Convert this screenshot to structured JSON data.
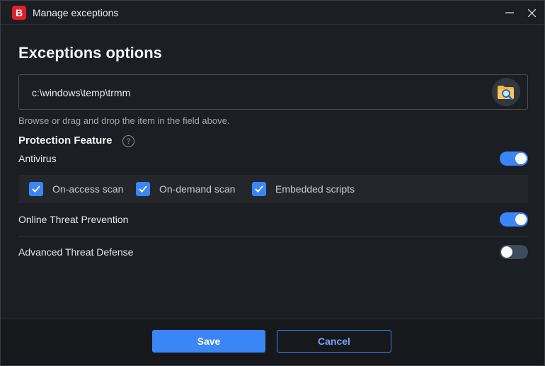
{
  "window": {
    "title": "Manage exceptions",
    "logo_letter": "B",
    "minimize_icon": "minimize-icon",
    "close_icon": "close-icon"
  },
  "content": {
    "heading": "Exceptions options",
    "path_value": "c:\\windows\\temp\\trmm",
    "browse_icon": "folder-search-icon",
    "hint": "Browse or drag and drop the item in the field above."
  },
  "protection": {
    "title": "Protection Feature",
    "help_icon_text": "?",
    "antivirus": {
      "label": "Antivirus",
      "enabled": true,
      "options": [
        {
          "label": "On-access scan",
          "checked": true
        },
        {
          "label": "On-demand scan",
          "checked": true
        },
        {
          "label": "Embedded scripts",
          "checked": true
        }
      ]
    },
    "online_threat": {
      "label": "Online Threat Prevention",
      "enabled": true
    },
    "advanced_threat": {
      "label": "Advanced Threat Defense",
      "enabled": false
    }
  },
  "footer": {
    "save_label": "Save",
    "cancel_label": "Cancel"
  },
  "colors": {
    "accent": "#3a86f7",
    "brand": "#e0202b",
    "background": "#1b1e22"
  }
}
